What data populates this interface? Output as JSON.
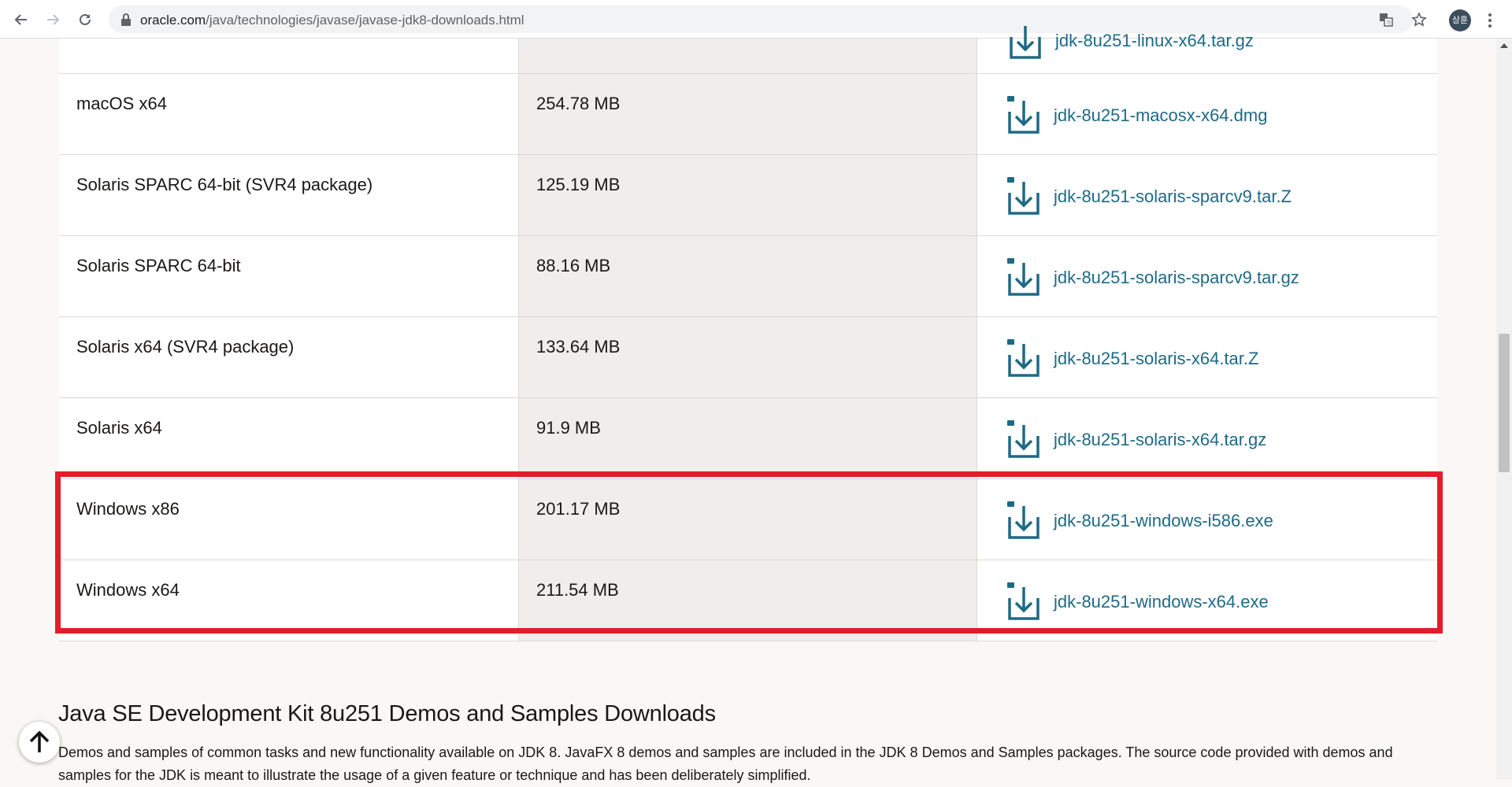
{
  "browser": {
    "url_domain": "oracle.com",
    "url_path": "/java/technologies/javase/javase-jdk8-downloads.html",
    "avatar_text": "상훈"
  },
  "table": {
    "partial_top_file": "jdk-8u251-linux-x64.tar.gz",
    "rows": [
      {
        "platform": "macOS x64",
        "size": "254.78 MB",
        "file": "jdk-8u251-macosx-x64.dmg"
      },
      {
        "platform": "Solaris SPARC 64-bit (SVR4 package)",
        "size": "125.19 MB",
        "file": "jdk-8u251-solaris-sparcv9.tar.Z"
      },
      {
        "platform": "Solaris SPARC 64-bit",
        "size": "88.16 MB",
        "file": "jdk-8u251-solaris-sparcv9.tar.gz"
      },
      {
        "platform": "Solaris x64 (SVR4 package)",
        "size": "133.64 MB",
        "file": "jdk-8u251-solaris-x64.tar.Z"
      },
      {
        "platform": "Solaris x64",
        "size": "91.9 MB",
        "file": "jdk-8u251-solaris-x64.tar.gz"
      },
      {
        "platform": "Windows x86",
        "size": "201.17 MB",
        "file": "jdk-8u251-windows-i586.exe"
      },
      {
        "platform": "Windows x64",
        "size": "211.54 MB",
        "file": "jdk-8u251-windows-x64.exe"
      }
    ]
  },
  "section": {
    "title": "Java SE Development Kit 8u251 Demos and Samples Downloads",
    "text": "Demos and samples of common tasks and new functionality available on JDK 8. JavaFX 8 demos and samples are included in the JDK 8 Demos and Samples packages. The source code provided with demos and samples for the JDK is meant to illustrate the usage of a given feature or technique and has been deliberately simplified."
  },
  "colors": {
    "link": "#1e6a86",
    "highlight": "#e21d2b",
    "size_column_bg": "#efeeec"
  },
  "icons": [
    "back-arrow-icon",
    "forward-arrow-icon",
    "reload-icon",
    "lock-icon",
    "translate-icon",
    "star-icon",
    "more-menu-icon",
    "download-icon",
    "arrow-up-icon"
  ]
}
